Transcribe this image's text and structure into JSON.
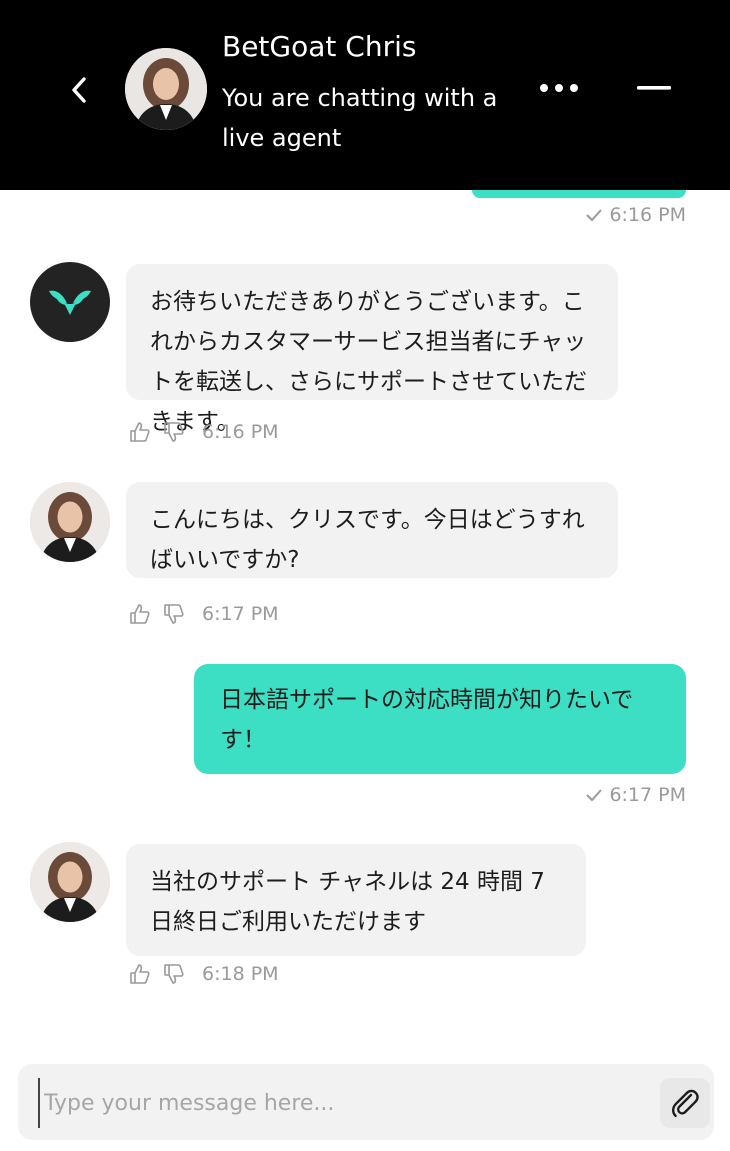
{
  "header": {
    "agent_name": "BetGoat Chris",
    "status": "You are chatting with a live agent",
    "back_icon": "chevron-left-icon",
    "more_icon": "more-horizontal-icon",
    "minimize_icon": "minimize-icon"
  },
  "messages": [
    {
      "direction": "outgoing",
      "time": "6:16 PM",
      "status_icon": "checkmark-icon"
    },
    {
      "direction": "incoming",
      "sender": "bot",
      "text": "お待ちいただきありがとうございます。これからカスタマーサービス担当者にチャットを転送し、さらにサポートさせていただきます。",
      "time": "6:16 PM"
    },
    {
      "direction": "incoming",
      "sender": "agent",
      "text": "こんにちは、クリスです。今日はどうすればいいですか?",
      "time": "6:17 PM"
    },
    {
      "direction": "outgoing",
      "text": "日本語サポートの対応時間が知りたいです！",
      "time": "6:17 PM",
      "status_icon": "checkmark-icon"
    },
    {
      "direction": "incoming",
      "sender": "agent",
      "text": "当社のサポート チャネルは 24 時間 7 日終日ご利用いただけます",
      "time": "6:18 PM"
    }
  ],
  "composer": {
    "placeholder": "Type your message here...",
    "attach_icon": "paperclip-icon"
  },
  "colors": {
    "header_bg": "#000000",
    "outgoing_bubble": "#3ddfc4",
    "incoming_bubble": "#f2f2f2",
    "brand_logo_green": "#3ddfc4",
    "meta_text": "#9a9a9a"
  }
}
